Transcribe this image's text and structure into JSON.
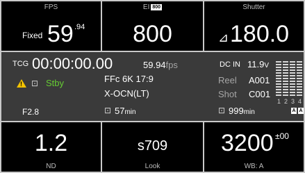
{
  "fps": {
    "label": "FPS",
    "mode": "Fixed",
    "value_main": "59",
    "value_dec": ".94"
  },
  "ei": {
    "label": "EI",
    "badge": "800",
    "value": "800"
  },
  "shutter": {
    "label": "Shutter",
    "symbol": "⊿",
    "value": "180.0"
  },
  "status": {
    "tcg_label": "TCG",
    "timecode": "00:00:00.00",
    "project_fps": "59.94",
    "fps_unit": "fps",
    "dc_label": "DC IN",
    "voltage": "11.9",
    "voltage_unit": "V",
    "rec_state": "Stby",
    "format_line1": "FFc 6K 17:9",
    "format_line2": "X-OCN(LT)",
    "iris": "F2.8",
    "media_remaining": "57",
    "media_unit": "min",
    "reel_label": "Reel",
    "reel_value": "A001",
    "shot_label": "Shot",
    "shot_value": "C001",
    "proxy_remaining": "999",
    "proxy_unit": "min",
    "audio_channels": [
      "1",
      "2",
      "3",
      "4"
    ],
    "audio_tags": [
      "A",
      "A"
    ]
  },
  "nd": {
    "label": "ND",
    "value": "1.2"
  },
  "look": {
    "label": "Look",
    "value": "s709"
  },
  "wb": {
    "label": "WB: A",
    "value": "3200",
    "offset": "±00"
  },
  "colors": {
    "warning": "#f2c200",
    "standby": "#66cc33",
    "panel": "#000000",
    "status_bg": "#3a3a3a"
  }
}
